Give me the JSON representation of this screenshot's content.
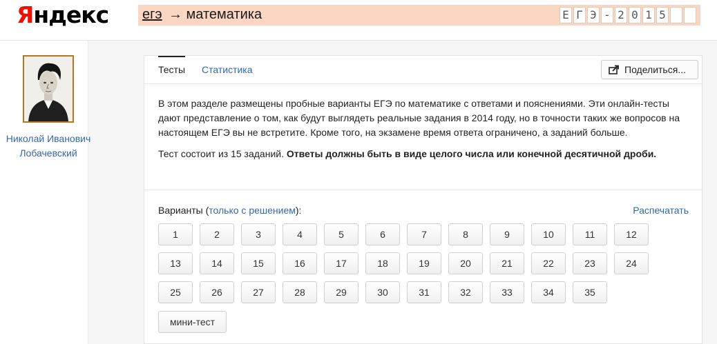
{
  "logo": {
    "first_letter": "Я",
    "rest": "ндекс"
  },
  "breadcrumb": {
    "link": "егэ",
    "rest": "→ математика",
    "tiles": [
      "Е",
      "Г",
      "Э",
      "-",
      "2",
      "0",
      "1",
      "5",
      "",
      ""
    ]
  },
  "author": {
    "name": "Николай Иванович Лобачевский"
  },
  "tabs": {
    "tests": "Тесты",
    "stats": "Статистика"
  },
  "share": {
    "label": "Поделиться..."
  },
  "description": {
    "p1": "В этом разделе размещены пробные варианты ЕГЭ по математике с ответами и пояснениями. Эти онлайн-тесты дают представление о том, как будут выглядеть реальные задания в 2014 году, но в точности таких же вопросов на настоящем ЕГЭ вы не встретите. Кроме того, на экзамене время ответа ограничено, а заданий больше.",
    "p2_normal": "Тест состоит из 15 заданий.",
    "p2_bold": "Ответы должны быть в виде целого числа или конечной десятичной дроби."
  },
  "variants": {
    "label": "Варианты (",
    "link": "только с решением",
    "suffix": "):",
    "print": "Распечатать",
    "numbers": [
      "1",
      "2",
      "3",
      "4",
      "5",
      "6",
      "7",
      "8",
      "9",
      "10",
      "11",
      "12",
      "13",
      "14",
      "15",
      "16",
      "17",
      "18",
      "19",
      "20",
      "21",
      "22",
      "23",
      "24",
      "25",
      "26",
      "27",
      "28",
      "29",
      "30",
      "31",
      "32",
      "33",
      "34",
      "35"
    ],
    "mini": "мини-тест"
  },
  "colors": {
    "accent_link": "#3366aa",
    "logo_red": "#e61400",
    "breadcrumb_bg": "#fbd6c2",
    "portrait_frame": "#b8751d"
  },
  "icons": {
    "share": "share-arrow-icon"
  }
}
